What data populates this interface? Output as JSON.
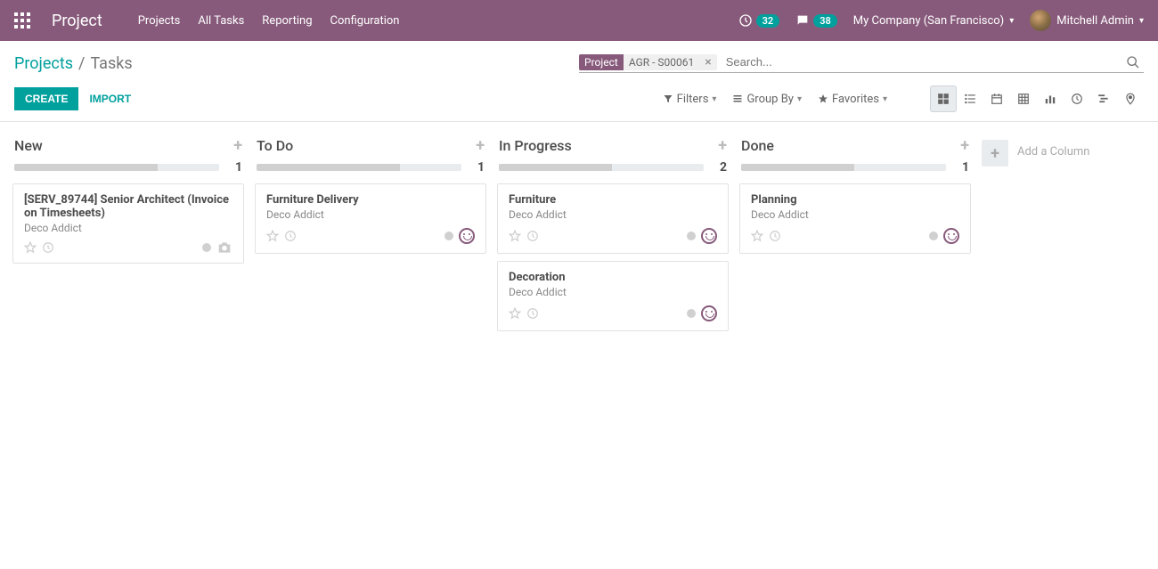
{
  "navbar": {
    "brand": "Project",
    "menu": [
      "Projects",
      "All Tasks",
      "Reporting",
      "Configuration"
    ],
    "activity_count": "32",
    "messages_count": "38",
    "company": "My Company (San Francisco)",
    "user": "Mitchell Admin"
  },
  "breadcrumb": {
    "parent": "Projects",
    "current": "Tasks"
  },
  "search": {
    "facet_label": "Project",
    "facet_value": "AGR - S00061",
    "placeholder": "Search..."
  },
  "buttons": {
    "create": "CREATE",
    "import": "IMPORT"
  },
  "search_options": {
    "filters": "Filters",
    "group_by": "Group By",
    "favorites": "Favorites"
  },
  "kanban": {
    "add_column": "Add a Column",
    "columns": [
      {
        "title": "New",
        "count": "1",
        "bar_pct": 70,
        "cards": [
          {
            "title": "[SERV_89744] Senior Architect (Invoice on Timesheets)",
            "subtitle": "Deco Addict",
            "face": false,
            "camera": true
          }
        ]
      },
      {
        "title": "To Do",
        "count": "1",
        "bar_pct": 70,
        "cards": [
          {
            "title": "Furniture Delivery",
            "subtitle": "Deco Addict",
            "face": true,
            "camera": false
          }
        ]
      },
      {
        "title": "In Progress",
        "count": "2",
        "bar_pct": 55,
        "cards": [
          {
            "title": "Furniture",
            "subtitle": "Deco Addict",
            "face": true,
            "camera": false
          },
          {
            "title": "Decoration",
            "subtitle": "Deco Addict",
            "face": true,
            "camera": false
          }
        ]
      },
      {
        "title": "Done",
        "count": "1",
        "bar_pct": 55,
        "cards": [
          {
            "title": "Planning",
            "subtitle": "Deco Addict",
            "face": true,
            "camera": false
          }
        ]
      }
    ]
  }
}
